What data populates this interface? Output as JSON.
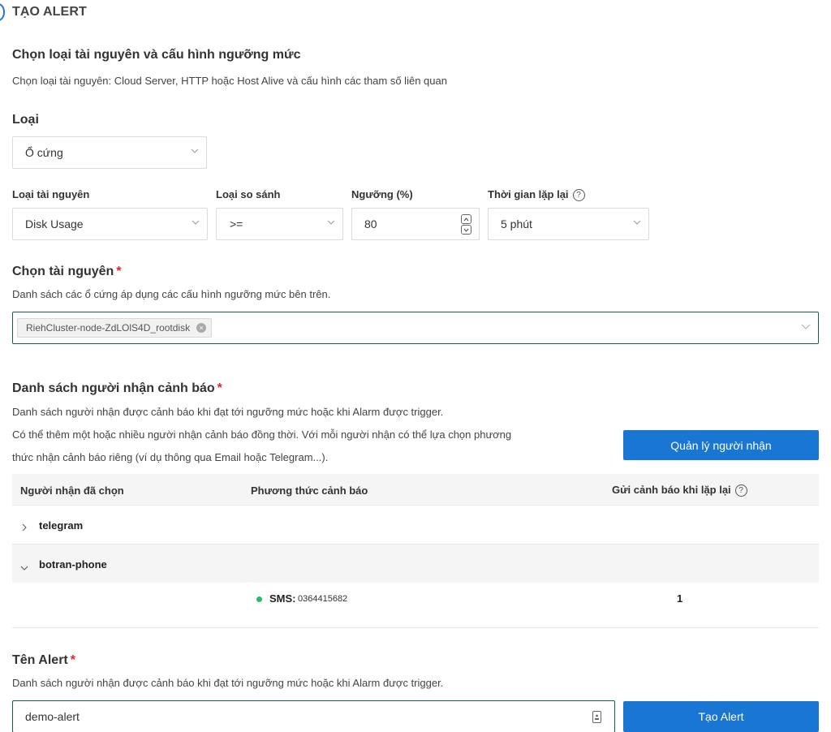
{
  "header": {
    "title": "TẠO ALERT"
  },
  "section1": {
    "title": "Chọn loại tài nguyên và cấu hình ngưỡng mức",
    "description": "Chọn loại tài nguyên: Cloud Server, HTTP hoặc Host Alive và cấu hình các tham số liên quan",
    "type_label": "Loại",
    "type_value": "Ổ cứng"
  },
  "config": {
    "resource_type": {
      "label": "Loại tài nguyên",
      "value": "Disk Usage"
    },
    "comparison": {
      "label": "Loại so sánh",
      "value": ">="
    },
    "threshold": {
      "label": "Ngưỡng (%)",
      "value": "80"
    },
    "repeat": {
      "label": "Thời gian lặp lại",
      "value": "5 phút",
      "help": "?"
    }
  },
  "resources": {
    "title": "Chọn tài nguyên",
    "required": "*",
    "description": "Danh sách các ổ cứng áp dụng các cấu hình ngưỡng mức bên trên.",
    "selected": [
      "RiehCluster-node-ZdLOlS4D_rootdisk"
    ],
    "remove_glyph": "×"
  },
  "recipients": {
    "title": "Danh sách người nhận cảnh báo",
    "required": "*",
    "description1": "Danh sách người nhận được cảnh báo khi đạt tới ngưỡng mức hoặc khi Alarm được trigger.",
    "description2_line1": "Có thể thêm một hoặc nhiều người nhận cảnh báo đồng thời. Với mỗi người nhận có thể lựa chọn phương",
    "description2_line2": "thức nhận cảnh báo riêng (ví dụ thông qua Email hoặc Telegram...).",
    "manage_button": "Quản lý người nhận",
    "table": {
      "col_recipient": "Người nhận đã chọn",
      "col_method": "Phương thức cảnh báo",
      "col_repeat": "Gửi cảnh báo khi lặp lại",
      "col_repeat_help": "?",
      "groups": [
        {
          "name": "telegram",
          "expanded": false
        },
        {
          "name": "botran-phone",
          "expanded": true
        }
      ],
      "detail": {
        "method": "SMS:",
        "target": "0364415682",
        "repeat": "1"
      }
    }
  },
  "alert_name": {
    "title": "Tên Alert",
    "required": "*",
    "description": "Danh sách người nhận được cảnh báo khi đạt tới ngưỡng mức hoặc khi Alarm được trigger.",
    "value": "demo-alert",
    "submit": "Tạo Alert"
  },
  "colors": {
    "primary": "#1976d2",
    "required": "#e0282e",
    "status_green": "#1ec06a",
    "input_focus": "#1a5b46"
  }
}
